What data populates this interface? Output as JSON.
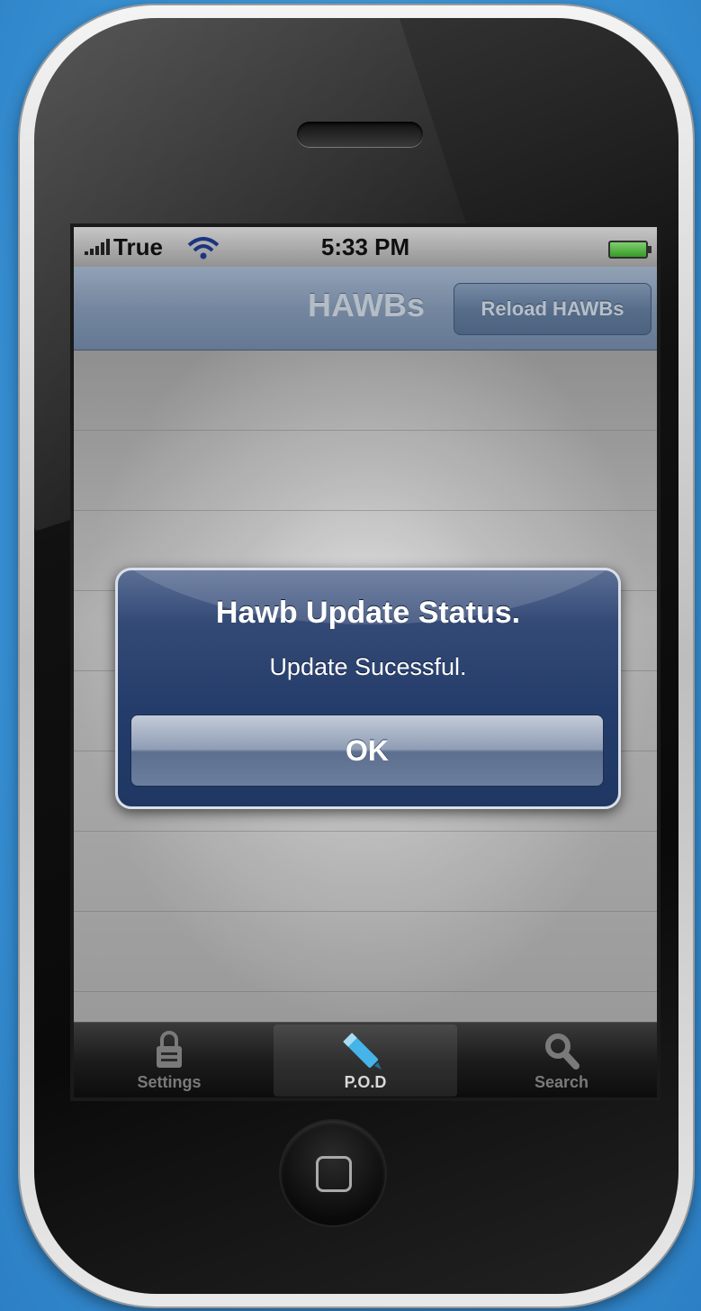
{
  "status_bar": {
    "carrier": "True",
    "time": "5:33 PM"
  },
  "nav_bar": {
    "title": "HAWBs",
    "reload_button": "Reload HAWBs"
  },
  "alert": {
    "title": "Hawb Update Status.",
    "message": "Update Sucessful.",
    "ok_button": "OK"
  },
  "tab_bar": {
    "tabs": [
      {
        "label": "Settings",
        "icon": "lock-icon",
        "selected": false
      },
      {
        "label": "P.O.D",
        "icon": "pencil-icon",
        "selected": true
      },
      {
        "label": "Search",
        "icon": "magnifier-icon",
        "selected": false
      }
    ]
  },
  "colors": {
    "background": "#3a94d6",
    "nav_bar": "#7f93ad",
    "alert": "#243c6a"
  }
}
